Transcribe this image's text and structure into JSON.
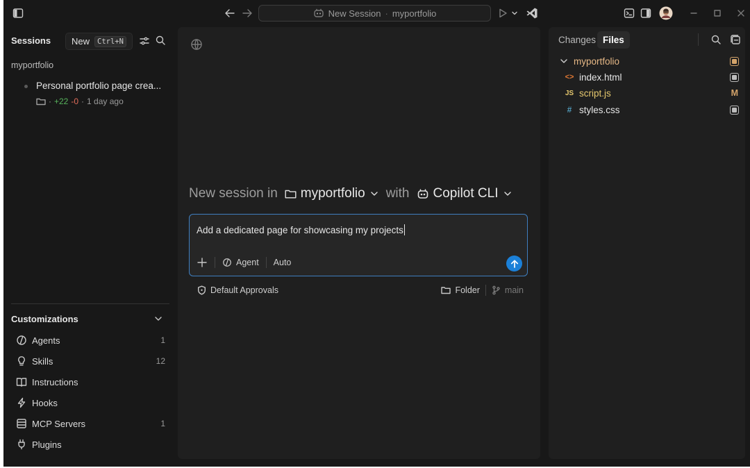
{
  "titlebar": {
    "session_title": "New Session",
    "separator": "·",
    "project": "myportfolio"
  },
  "sessions": {
    "header": "Sessions",
    "new_label": "New",
    "new_shortcut": "Ctrl+N",
    "repo": "myportfolio",
    "items": [
      {
        "title": "Personal portfolio page crea...",
        "dot": "·",
        "added": "+22",
        "removed": "-0",
        "sep": "·",
        "time": "1 day ago"
      }
    ]
  },
  "customizations": {
    "header": "Customizations",
    "items": [
      {
        "label": "Agents",
        "count": "1",
        "icon": "agent-icon"
      },
      {
        "label": "Skills",
        "count": "12",
        "icon": "lightbulb-icon"
      },
      {
        "label": "Instructions",
        "count": "",
        "icon": "book-icon"
      },
      {
        "label": "Hooks",
        "count": "",
        "icon": "lightning-icon"
      },
      {
        "label": "MCP Servers",
        "count": "1",
        "icon": "server-icon"
      },
      {
        "label": "Plugins",
        "count": "",
        "icon": "plug-icon"
      }
    ]
  },
  "main": {
    "prefix": "New session in",
    "folder": "myportfolio",
    "with": "with",
    "agent": "Copilot CLI",
    "prompt": "Add a dedicated page for showcasing my projects",
    "mode": "Agent",
    "model": "Auto",
    "approvals": "Default Approvals",
    "folder_label": "Folder",
    "branch": "main"
  },
  "files_panel": {
    "tabs": [
      "Changes",
      "Files"
    ],
    "active_tab": "Files",
    "tree": [
      {
        "name": "myportfolio",
        "type": "folder",
        "icon_text": "",
        "color": "#e6b886",
        "badge": "box-orange"
      },
      {
        "name": "index.html",
        "type": "html",
        "icon_text": "<>",
        "color": "#e6e6e6",
        "badge": "box"
      },
      {
        "name": "script.js",
        "type": "js",
        "icon_text": "JS",
        "color": "#e6c86e",
        "badge": "M"
      },
      {
        "name": "styles.css",
        "type": "css",
        "icon_text": "#",
        "color": "#e6e6e6",
        "badge": "box"
      }
    ]
  },
  "colors": {
    "accent": "#1b80d8",
    "added": "#57b35c",
    "removed": "#e06c5a",
    "modified": "#d3a36a",
    "js": "#e6c86e",
    "html_icon": "#e37933",
    "css_icon": "#519aba"
  }
}
